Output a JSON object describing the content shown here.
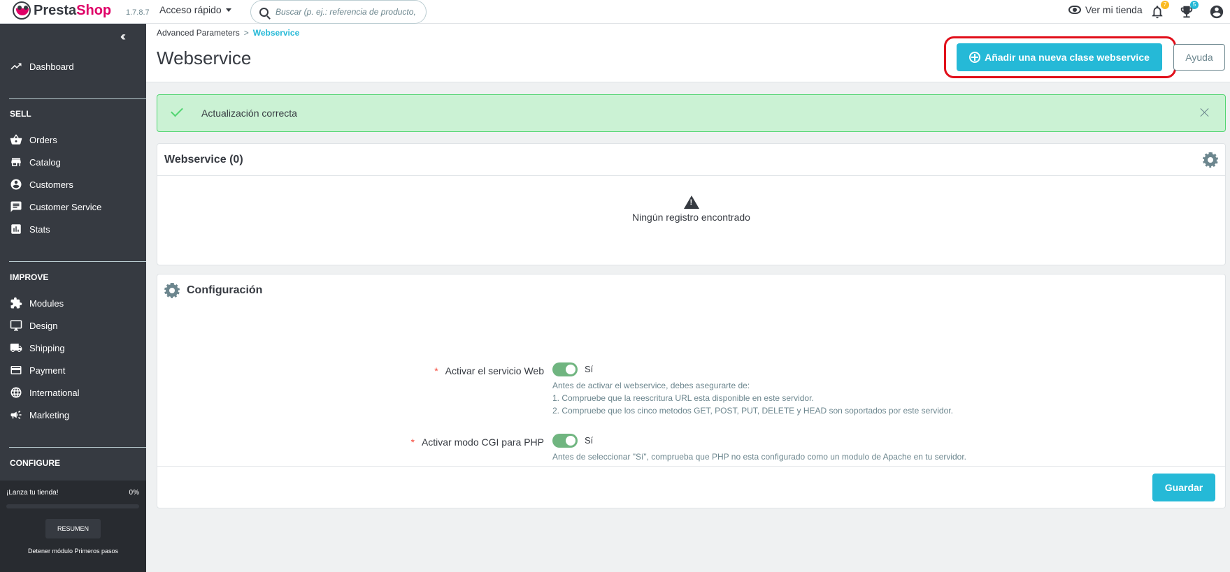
{
  "header": {
    "logo_text_presta": "Presta",
    "logo_text_shop": "Shop",
    "version": "1.7.8.7",
    "quick_access": "Acceso rápido",
    "search_placeholder": "Buscar (p. ej.: referencia de producto,",
    "view_store": "Ver mi tienda",
    "notifications_count": "7",
    "trophy_count": "5"
  },
  "sidebar": {
    "dashboard": "Dashboard",
    "sell_title": "SELL",
    "sell_items": [
      "Orders",
      "Catalog",
      "Customers",
      "Customer Service",
      "Stats"
    ],
    "improve_title": "IMPROVE",
    "improve_items": [
      "Modules",
      "Design",
      "Shipping",
      "Payment",
      "International",
      "Marketing"
    ],
    "configure_title": "CONFIGURE",
    "launch_label": "¡Lanza tu tienda!",
    "launch_percent": "0%",
    "launch_progress": 0,
    "resumen": "RESUMEN",
    "stop_module": "Detener módulo Primeros pasos"
  },
  "page": {
    "breadcrumb_parent": "Advanced Parameters",
    "breadcrumb_sep": ">",
    "breadcrumb_current": "Webservice",
    "title": "Webservice",
    "add_button": "Añadir una nueva clase webservice",
    "help_button": "Ayuda"
  },
  "alert": {
    "text": "Actualización correcta"
  },
  "list_panel": {
    "title": "Webservice (0)",
    "empty_text": "Ningún registro encontrado"
  },
  "config_panel": {
    "title": "Configuración",
    "field1_label": "Activar el servicio Web",
    "field1_value": "Sí",
    "field1_help": [
      "Antes de activar el webservice, debes asegurarte de:",
      "1. Compruebe que la reescritura URL esta disponible en este servidor.",
      "2. Compruebe que los cinco metodos GET, POST, PUT, DELETE y HEAD son soportados por este servidor."
    ],
    "field2_label": "Activar modo CGI para PHP",
    "field2_value": "Sí",
    "field2_help": "Antes de seleccionar \"Sí\", comprueba que PHP no esta configurado como un modulo de Apache en tu servidor.",
    "save_button": "Guardar"
  },
  "colors": {
    "accent": "#25b9d7",
    "sidebar_bg": "#363a41",
    "success_bg": "#cbf2d4",
    "success_border": "#53d572",
    "toggle_on": "#70b580",
    "highlight": "#e10f1a",
    "logo_pink": "#df0067"
  }
}
